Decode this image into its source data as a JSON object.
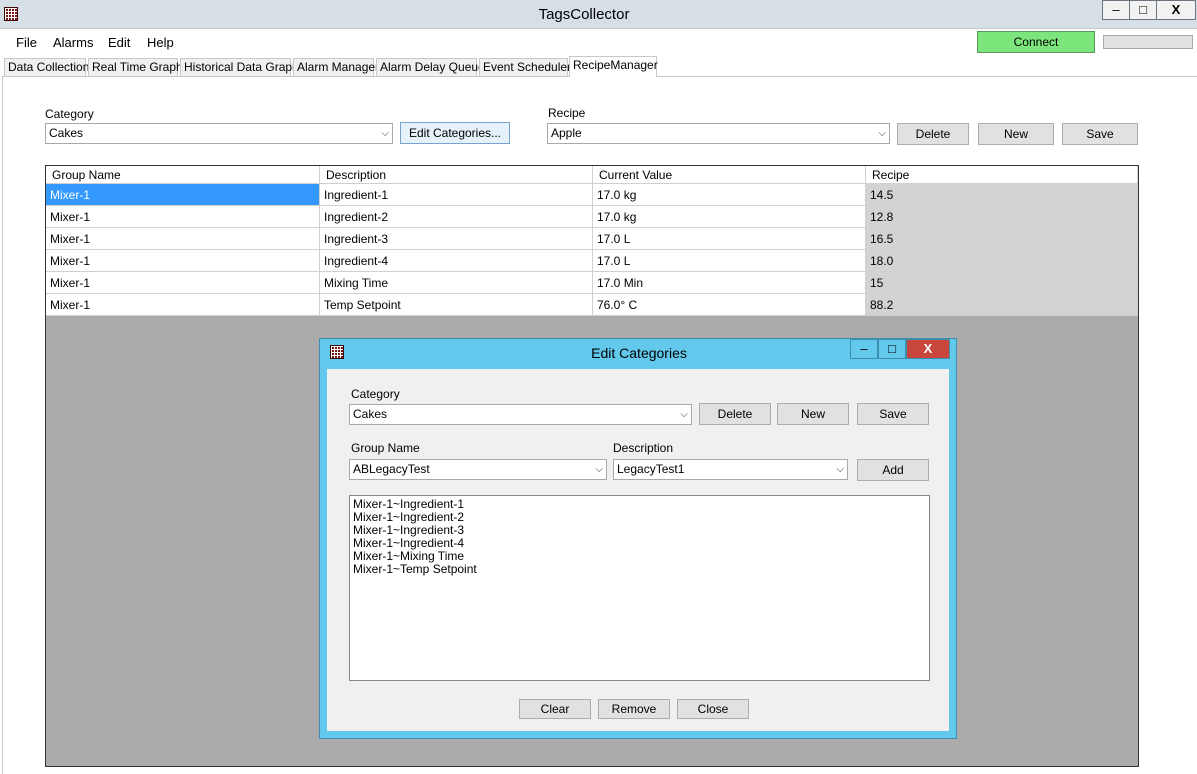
{
  "window": {
    "title": "TagsCollector",
    "min": "–",
    "max": "□",
    "close": "X"
  },
  "menu": [
    "File",
    "Alarms",
    "Edit",
    "Help"
  ],
  "connect_label": "Connect",
  "tabs": [
    "Data Collection",
    "Real Time Graph",
    "Historical Data Graph",
    "Alarm Manager",
    "Alarm Delay Queue",
    "Event Scheduler",
    "RecipeManager"
  ],
  "recipe_manager": {
    "category_label": "Category",
    "category_value": "Cakes",
    "edit_categories_label": "Edit Categories...",
    "recipe_label": "Recipe",
    "recipe_value": "Apple",
    "delete_label": "Delete",
    "new_label": "New",
    "save_label": "Save"
  },
  "grid": {
    "columns": [
      "Group Name",
      "Description",
      "Current Value",
      "Recipe"
    ],
    "rows": [
      [
        "Mixer-1",
        "Ingredient-1",
        "17.0 kg",
        "14.5"
      ],
      [
        "Mixer-1",
        "Ingredient-2",
        "17.0 kg",
        "12.8"
      ],
      [
        "Mixer-1",
        "Ingredient-3",
        "17.0 L",
        "16.5"
      ],
      [
        "Mixer-1",
        "Ingredient-4",
        "17.0 L",
        "18.0"
      ],
      [
        "Mixer-1",
        "Mixing Time",
        "17.0 Min",
        "15"
      ],
      [
        "Mixer-1",
        "Temp Setpoint",
        "76.0° C",
        "88.2"
      ]
    ]
  },
  "dialog": {
    "title": "Edit Categories",
    "category_label": "Category",
    "category_value": "Cakes",
    "delete_label": "Delete",
    "new_label": "New",
    "save_label": "Save",
    "group_label": "Group Name",
    "group_value": "ABLegacyTest",
    "desc_label": "Description",
    "desc_value": "LegacyTest1",
    "add_label": "Add",
    "list": [
      "Mixer-1~Ingredient-1",
      "Mixer-1~Ingredient-2",
      "Mixer-1~Ingredient-3",
      "Mixer-1~Ingredient-4",
      "Mixer-1~Mixing Time",
      "Mixer-1~Temp Setpoint"
    ],
    "clear_label": "Clear",
    "remove_label": "Remove",
    "close_label": "Close"
  },
  "colors": {
    "connect": "#7ce67c",
    "dialog_frame": "#62c8ec",
    "selected": "#3399ff"
  }
}
